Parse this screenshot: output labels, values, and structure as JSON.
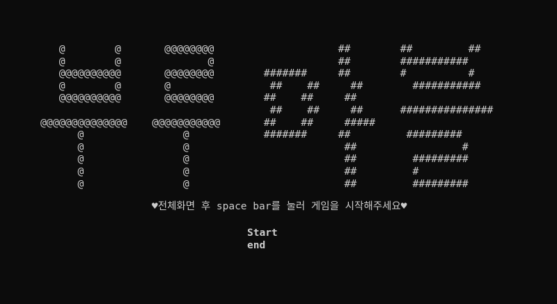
{
  "title_art": [
    "   @        @       @@@@@@@@                    ##        ##         ##",
    "   @        @              @                    ##        ###########",
    "   @@@@@@@@@@       @@@@@@@@        #######     ##        #          #",
    "   @        @       @                ##    ##     ##        ###########",
    "   @@@@@@@@@@       @@@@@@@@        ##    ##     ##",
    "                                     ##    ##     ##      ###############",
    "@@@@@@@@@@@@@@    @@@@@@@@@@@       ##    ##     #####",
    "      @                @            #######     ##         #########",
    "      @                @                         ##                 #",
    "      @                @                         ##         #########",
    "      @                @                         ##         #",
    "      @                @                         ##         #########"
  ],
  "instruction": "♥전체화면 후 space bar를 눌러 게임을 시작해주세요♥",
  "menu": {
    "start": "Start",
    "end": "end"
  }
}
